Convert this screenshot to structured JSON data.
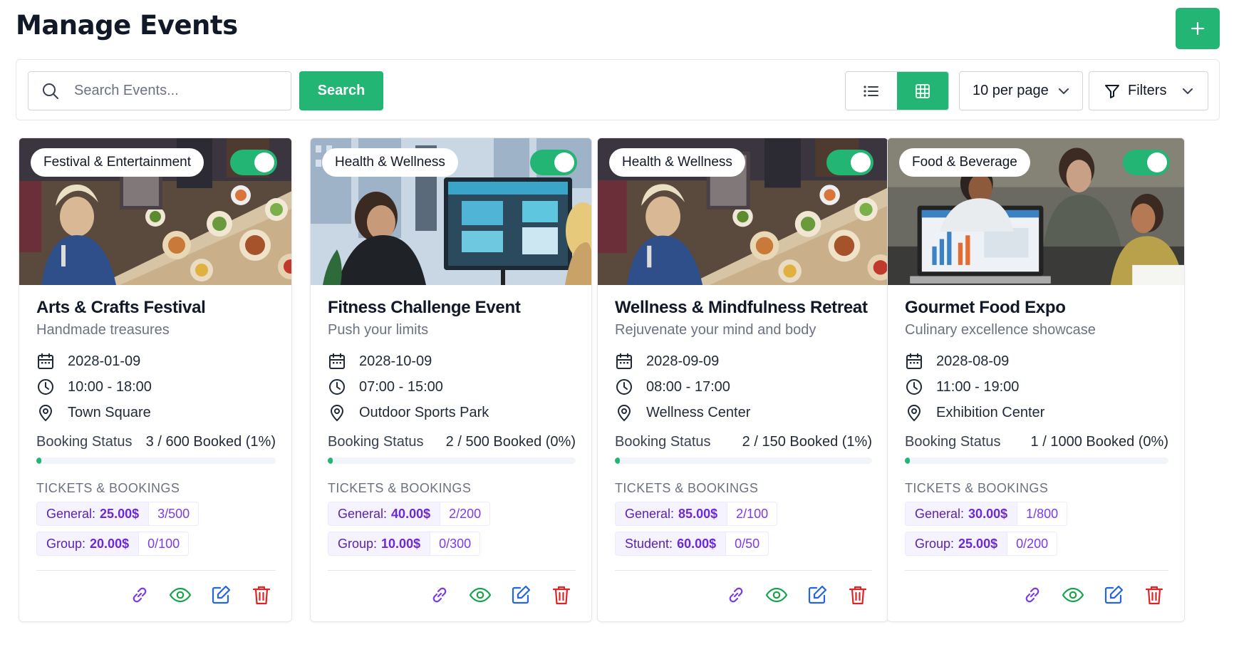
{
  "header": {
    "title": "Manage Events"
  },
  "toolbar": {
    "search_placeholder": "Search Events...",
    "search_label": "Search",
    "per_page": "10 per page",
    "filters_label": "Filters"
  },
  "colors": {
    "accent": "#22b573",
    "purple": "#7c3aed",
    "blue": "#2563eb",
    "red": "#dc2626",
    "green": "#16a34a"
  },
  "events": [
    {
      "category": "Festival & Entertainment",
      "title": "Arts & Crafts Festival",
      "subtitle": "Handmade treasures",
      "date": "2028-01-09",
      "time": "10:00 - 18:00",
      "location": "Town Square",
      "booking_label": "Booking Status",
      "booking_value": "3 / 600 Booked (1%)",
      "booking_fraction": 0.01,
      "tickets_heading": "TICKETS & BOOKINGS",
      "tickets": [
        {
          "name": "General:",
          "price": "25.00$",
          "count": "3/500"
        },
        {
          "name": "Group:",
          "price": "20.00$",
          "count": "0/100"
        }
      ],
      "image": "food-party"
    },
    {
      "category": "Health & Wellness",
      "title": "Fitness Challenge Event",
      "subtitle": "Push your limits",
      "date": "2028-10-09",
      "time": "07:00 - 15:00",
      "location": "Outdoor Sports Park",
      "booking_label": "Booking Status",
      "booking_value": "2 / 500 Booked (0%)",
      "booking_fraction": 0.004,
      "tickets_heading": "TICKETS & BOOKINGS",
      "tickets": [
        {
          "name": "General:",
          "price": "40.00$",
          "count": "2/200"
        },
        {
          "name": "Group:",
          "price": "10.00$",
          "count": "0/300"
        }
      ],
      "image": "office-screen"
    },
    {
      "category": "Health & Wellness",
      "title": "Wellness & Mindfulness Retreat",
      "subtitle": "Rejuvenate your mind and body",
      "date": "2028-09-09",
      "time": "08:00 - 17:00",
      "location": "Wellness Center",
      "booking_label": "Booking Status",
      "booking_value": "2 / 150 Booked (1%)",
      "booking_fraction": 0.013,
      "tickets_heading": "TICKETS & BOOKINGS",
      "tickets": [
        {
          "name": "General:",
          "price": "85.00$",
          "count": "2/100"
        },
        {
          "name": "Student:",
          "price": "60.00$",
          "count": "0/50"
        }
      ],
      "image": "food-party"
    },
    {
      "category": "Food & Beverage",
      "title": "Gourmet Food Expo",
      "subtitle": "Culinary excellence showcase",
      "date": "2028-08-09",
      "time": "11:00 - 19:00",
      "location": "Exhibition Center",
      "booking_label": "Booking Status",
      "booking_value": "1 / 1000 Booked (0%)",
      "booking_fraction": 0.001,
      "tickets_heading": "TICKETS & BOOKINGS",
      "tickets": [
        {
          "name": "General:",
          "price": "30.00$",
          "count": "1/800"
        },
        {
          "name": "Group:",
          "price": "25.00$",
          "count": "0/200"
        }
      ],
      "image": "team-laptop"
    }
  ]
}
